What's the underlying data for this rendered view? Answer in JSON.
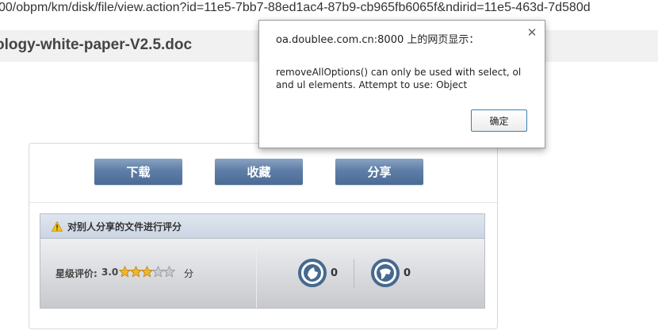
{
  "address_bar": {
    "url": "00/obpm/km/disk/file/view.action?id=11e5-7bb7-88ed1ac4-87b9-cb965fb6065f&ndirid=11e5-463d-7d580d"
  },
  "file": {
    "title": "ology-white-paper-V2.5.doc"
  },
  "actions": {
    "download_label": "下载",
    "collect_label": "收藏",
    "share_label": "分享"
  },
  "rating": {
    "header_icon": "warning-icon",
    "header_title": "对别人分享的文件进行评分",
    "star_label": "星级评价:",
    "score": "3.0",
    "stars_filled": 3,
    "stars_total": 5,
    "unit": "分",
    "upvote_icon": "thumbs-up-icon",
    "upvote_count": "0",
    "downvote_icon": "thumbs-down-icon",
    "downvote_count": "0"
  },
  "dialog": {
    "title": "oa.doublee.com.cn:8000 上的网页显示：",
    "message": "removeAllOptions() can only be used with select, ol and ul elements. Attempt to use: Object",
    "ok_label": "确定",
    "close_icon": "close-icon"
  },
  "colors": {
    "button_blue": "#5e7ea7",
    "star_gold": "#f2b52b",
    "vote_icon_blue": "#46698f"
  }
}
